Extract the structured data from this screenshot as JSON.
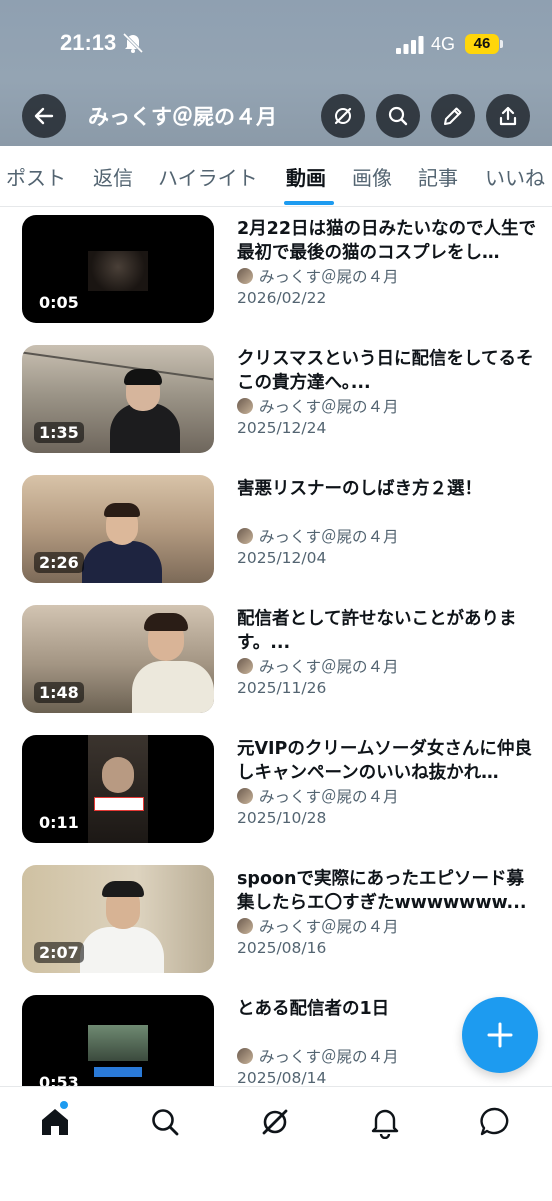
{
  "status_bar": {
    "time": "21:13",
    "network": "4G",
    "battery": "46"
  },
  "header": {
    "profile_name": "みっくす＠屍の４月"
  },
  "tabs": [
    "ポスト",
    "返信",
    "ハイライト",
    "動画",
    "画像",
    "記事",
    "いいね"
  ],
  "active_tab": "動画",
  "videos": [
    {
      "title": "2月22日は猫の日みたいなので人生で最初で最後の猫のコスプレをし…",
      "author": "みっくす＠屍の４月",
      "date": "2026/02/22",
      "duration": "0:05"
    },
    {
      "title": "クリスマスという日に配信をしてるそこの貴方達へ｡...",
      "author": "みっくす＠屍の４月",
      "date": "2025/12/24",
      "duration": "1:35"
    },
    {
      "title": "害悪リスナーのしばき方２選！",
      "author": "みっくす＠屍の４月",
      "date": "2025/12/04",
      "duration": "2:26"
    },
    {
      "title": "配信者として許せないことがあります。...",
      "author": "みっくす＠屍の４月",
      "date": "2025/11/26",
      "duration": "1:48"
    },
    {
      "title": "元VIPのクリームソーダ女さんに仲良しキャンペーンのいいね抜かれ…",
      "author": "みっくす＠屍の４月",
      "date": "2025/10/28",
      "duration": "0:11"
    },
    {
      "title": "spoonで実際にあったエピソード募集したらエ〇すぎたwwwwwww...",
      "author": "みっくす＠屍の４月",
      "date": "2025/08/16",
      "duration": "2:07"
    },
    {
      "title": "とある配信者の1日",
      "author": "みっくす＠屍の４月",
      "date": "2025/08/14",
      "duration": "0:53"
    }
  ],
  "icons": {
    "back": "back-arrow-icon",
    "grok": "grok-icon",
    "search": "search-icon",
    "edit": "pencil-icon",
    "share": "share-icon",
    "compose": "plus-icon",
    "nav": [
      "home-icon",
      "search-icon",
      "grok-icon",
      "bell-icon",
      "message-icon"
    ]
  },
  "colors": {
    "accent": "#1d9bf0",
    "text": "#0f1419",
    "muted": "#536471",
    "battery": "#ffd60a"
  }
}
